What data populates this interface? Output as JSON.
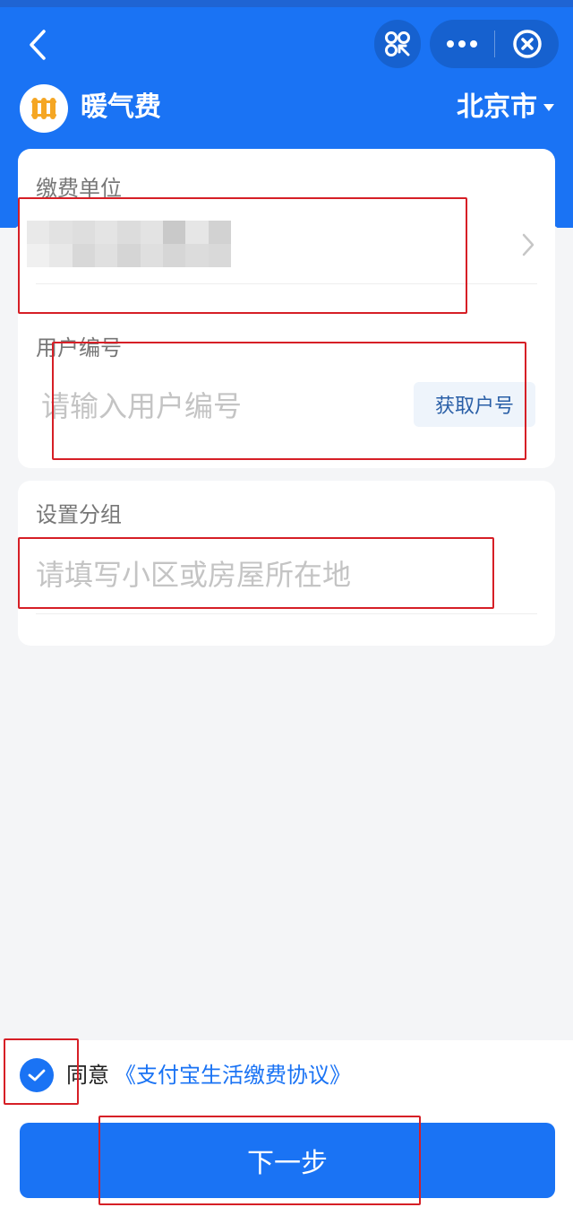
{
  "header": {
    "title": "暖气费",
    "city": "北京市",
    "back_icon": "chevron-left-icon",
    "scan_icon": "scan-icon",
    "more_icon": "more-icon",
    "close_icon": "close-circle-icon"
  },
  "logo": {
    "icon": "radiator-icon",
    "color": "#f5a623"
  },
  "form": {
    "payment_unit": {
      "label": "缴费单位"
    },
    "user_id": {
      "label": "用户编号",
      "placeholder": "请输入用户编号",
      "button": "获取户号"
    },
    "group": {
      "label": "设置分组",
      "placeholder": "请填写小区或房屋所在地"
    }
  },
  "agreement": {
    "prefix": "同意",
    "link": "《支付宝生活缴费协议》",
    "checked": true
  },
  "next_button": "下一步",
  "colors": {
    "primary": "#1a73f4",
    "annotation": "#d61f26",
    "background": "#f4f5f7"
  }
}
